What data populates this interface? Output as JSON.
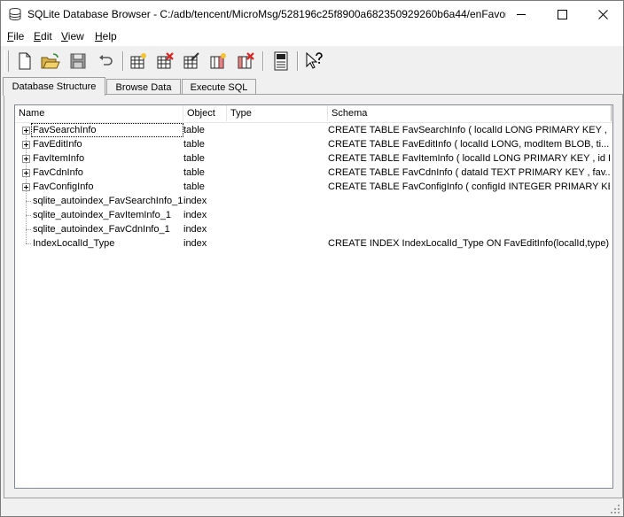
{
  "window": {
    "title": "SQLite Database Browser - C:/adb/tencent/MicroMsg/528196c25f8900a682350929260b6a44/enFavor...",
    "minimize_glyph": "—",
    "maximize_glyph": "☐",
    "close_glyph": "✕"
  },
  "menu": [
    {
      "u": "F",
      "rest": "ile"
    },
    {
      "u": "E",
      "rest": "dit"
    },
    {
      "u": "V",
      "rest": "iew"
    },
    {
      "u": "H",
      "rest": "elp"
    }
  ],
  "tabs": [
    {
      "label": "Database Structure"
    },
    {
      "label": "Browse Data"
    },
    {
      "label": "Execute SQL"
    }
  ],
  "columns": [
    "Name",
    "Object",
    "Type",
    "Schema"
  ],
  "rows": [
    {
      "name": "FavSearchInfo",
      "object": "table",
      "type": "",
      "schema": "CREATE TABLE FavSearchInfo (  localId LONG PRIMARY KEY ,  ..."
    },
    {
      "name": "FavEditInfo",
      "object": "table",
      "type": "",
      "schema": "CREATE TABLE FavEditInfo (  localId LONG,  modItem BLOB,  ti..."
    },
    {
      "name": "FavItemInfo",
      "object": "table",
      "type": "",
      "schema": "CREATE TABLE FavItemInfo (  localId LONG PRIMARY KEY ,  id I..."
    },
    {
      "name": "FavCdnInfo",
      "object": "table",
      "type": "",
      "schema": "CREATE TABLE FavCdnInfo (  dataId TEXT PRIMARY KEY ,  fav..."
    },
    {
      "name": "FavConfigInfo",
      "object": "table",
      "type": "",
      "schema": "CREATE TABLE FavConfigInfo (  configId INTEGER PRIMARY KE..."
    },
    {
      "name": "sqlite_autoindex_FavSearchInfo_1",
      "object": "index",
      "type": "",
      "schema": ""
    },
    {
      "name": "sqlite_autoindex_FavItemInfo_1",
      "object": "index",
      "type": "",
      "schema": ""
    },
    {
      "name": "sqlite_autoindex_FavCdnInfo_1",
      "object": "index",
      "type": "",
      "schema": ""
    },
    {
      "name": "IndexLocalId_Type",
      "object": "index",
      "type": "",
      "schema": "CREATE INDEX IndexLocalId_Type ON FavEditInfo(localId,type)"
    }
  ],
  "toolbar_icons": [
    "new-database-icon",
    "open-database-icon",
    "save-database-icon",
    "undo-icon",
    "create-table-icon",
    "delete-table-icon",
    "modify-table-icon",
    "create-index-icon",
    "delete-index-icon",
    "sql-log-icon",
    "whats-this-icon"
  ]
}
